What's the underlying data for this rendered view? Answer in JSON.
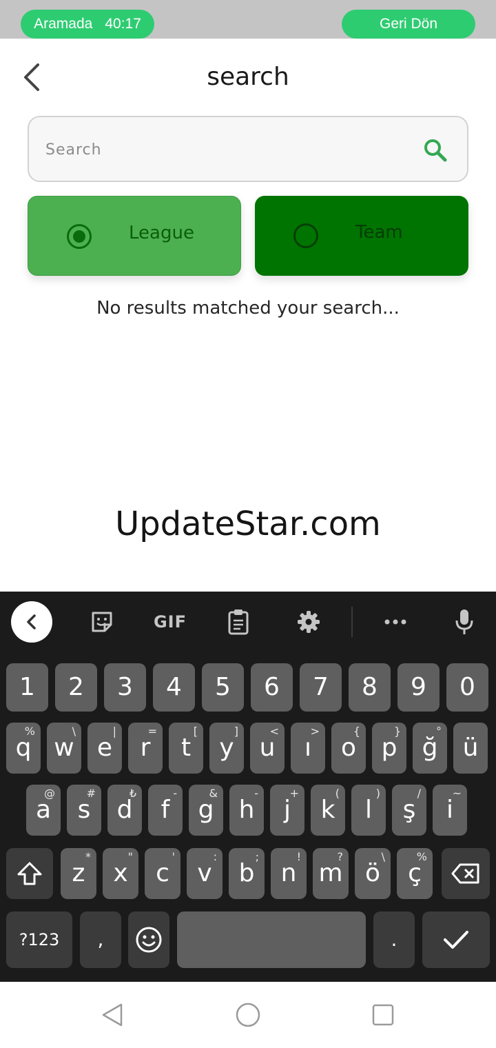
{
  "call_bar": {
    "status": "Aramada",
    "timer": "40:17",
    "return_label": "Geri Dön"
  },
  "header": {
    "title": "search"
  },
  "search": {
    "placeholder": "Search",
    "value": ""
  },
  "toggles": [
    {
      "label": "League",
      "selected": true
    },
    {
      "label": "Team",
      "selected": false
    }
  ],
  "results": {
    "empty_message": "No results matched your search..."
  },
  "watermark": "UpdateStar.com",
  "keyboard": {
    "toolbar": {
      "gif_label": "GIF"
    },
    "number_row": [
      "1",
      "2",
      "3",
      "4",
      "5",
      "6",
      "7",
      "8",
      "9",
      "0"
    ],
    "row1": [
      {
        "k": "q",
        "s": "%"
      },
      {
        "k": "w",
        "s": "\\"
      },
      {
        "k": "e",
        "s": "|"
      },
      {
        "k": "r",
        "s": "="
      },
      {
        "k": "t",
        "s": "["
      },
      {
        "k": "y",
        "s": "]"
      },
      {
        "k": "u",
        "s": "<"
      },
      {
        "k": "ı",
        "s": ">"
      },
      {
        "k": "o",
        "s": "{"
      },
      {
        "k": "p",
        "s": "}"
      },
      {
        "k": "ğ",
        "s": "°"
      },
      {
        "k": "ü",
        "s": ""
      }
    ],
    "row2": [
      {
        "k": "a",
        "s": "@"
      },
      {
        "k": "s",
        "s": "#"
      },
      {
        "k": "d",
        "s": "₺"
      },
      {
        "k": "f",
        "s": "-"
      },
      {
        "k": "g",
        "s": "&"
      },
      {
        "k": "h",
        "s": "-"
      },
      {
        "k": "j",
        "s": "+"
      },
      {
        "k": "k",
        "s": "("
      },
      {
        "k": "l",
        "s": ")"
      },
      {
        "k": "ş",
        "s": "/"
      },
      {
        "k": "i",
        "s": "~"
      }
    ],
    "row3": [
      {
        "k": "z",
        "s": "*"
      },
      {
        "k": "x",
        "s": "\""
      },
      {
        "k": "c",
        "s": "'"
      },
      {
        "k": "v",
        "s": ":"
      },
      {
        "k": "b",
        "s": ";"
      },
      {
        "k": "n",
        "s": "!"
      },
      {
        "k": "m",
        "s": "?"
      },
      {
        "k": "ö",
        "s": "\\"
      },
      {
        "k": "ç",
        "s": "%"
      }
    ],
    "bottom": {
      "symbols_label": "?123",
      "comma": ",",
      "period": "."
    }
  }
}
